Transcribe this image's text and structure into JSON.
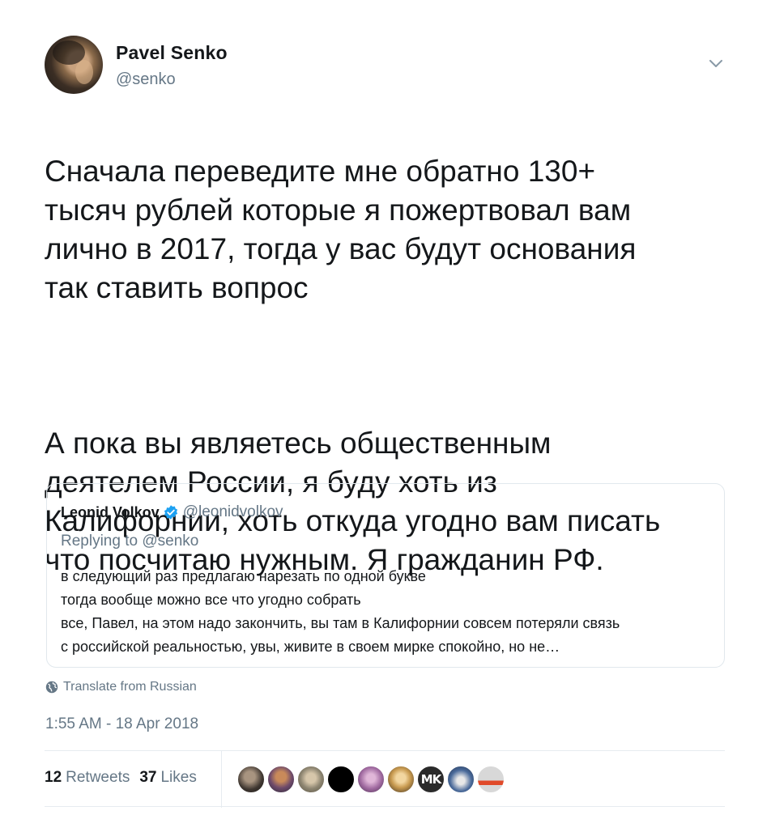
{
  "author": {
    "name": "Pavel Senko",
    "handle": "@senko",
    "avatar_icon": "user-avatar-photo"
  },
  "tweet": {
    "paragraph_1": "Сначала переведите мне обратно 130+\nтысяч рублей которые я пожертвовал вам\nлично в 2017, тогда у вас будут основания\nтак ставить вопрос",
    "paragraph_2": "А пока вы являетесь общественным\nдеятелем России, я буду хоть из\nКалифорнии, хоть откуда угодно вам писать\nчто посчитаю нужным. Я гражданин РФ."
  },
  "quoted_tweet": {
    "name": "Leonid Volkov",
    "verified": true,
    "handle": "@leonidvolkov",
    "replying_prefix": "Replying to",
    "replying_to": "@senko",
    "lines": [
      "в следующий раз предлагаю нарезать по одной букве",
      "тогда вообще можно все что угодно собрать",
      "все, Павел, на этом надо закончить, вы там в Калифорнии совсем потеряли связь",
      "с российской реальностью, увы, живите в своем мирке спокойно, но не…"
    ]
  },
  "translate_label": "Translate from Russian",
  "timestamp": "1:55 AM - 18 Apr 2018",
  "stats": {
    "retweets_count": "12",
    "retweets_label": "Retweets",
    "likes_count": "37",
    "likes_label": "Likes"
  },
  "likers_avatar_count": 10,
  "mk_avatar_text": "MK",
  "colors": {
    "text_primary": "#14171a",
    "text_secondary": "#657786",
    "verified_blue": "#1da1f2",
    "border": "#e1e8ed"
  }
}
